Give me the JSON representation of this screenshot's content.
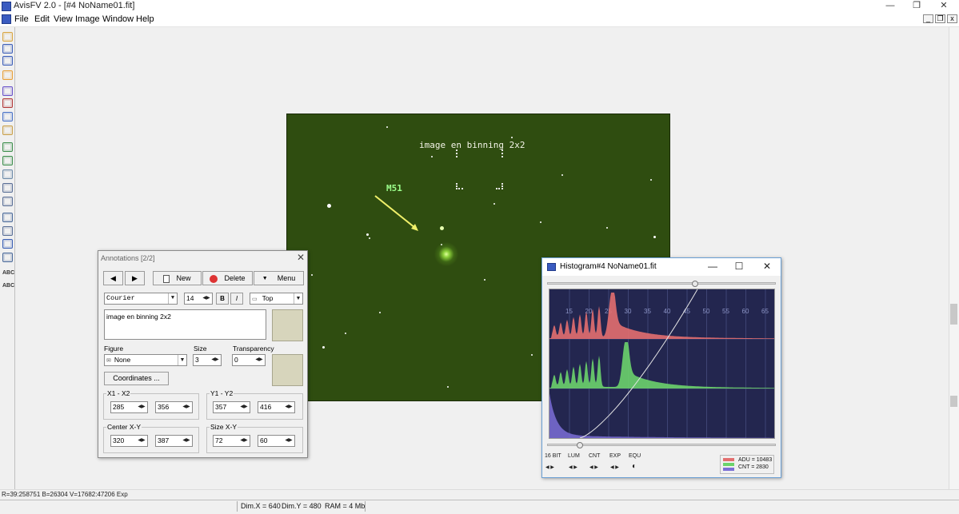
{
  "app": {
    "title": "AvisFV 2.0 - [#4 NoName01.fit]",
    "window_buttons": [
      "—",
      "❐",
      "✕"
    ],
    "mdi_buttons": [
      "_",
      "❐",
      "x"
    ]
  },
  "menu": {
    "items": [
      "File",
      "Edit",
      "View",
      "Image",
      "Window",
      "Help"
    ]
  },
  "toolbar": {
    "icons": [
      "open-icon",
      "save-icon",
      "save-as-icon",
      "folder-icon",
      "refresh-icon",
      "convert-icon",
      "copy-icon",
      "paste-icon",
      "zoom-in-icon",
      "zoom-out-icon",
      "display-icon",
      "crop-icon",
      "target-icon",
      "frame-icon",
      "histogram-icon",
      "levels-icon",
      "sigma-icon",
      "abc-icon",
      "abc-edit-icon"
    ],
    "colors": [
      "#d9a641",
      "#3d5fb8",
      "#3d5fb8",
      "#e8a03a",
      "#6a53c9",
      "#b23a3a",
      "#4a73c7",
      "#c9a04a",
      "#3f8f4e",
      "#3f8f4e",
      "#6c8aa8",
      "#5a6f96",
      "#5a6f96",
      "#4a6a9a",
      "#5a6f96",
      "#3a5fb4",
      "#4a6a9a",
      "#333333",
      "#333333"
    ]
  },
  "image": {
    "caption": "image en binning 2x2",
    "object_label": "M51"
  },
  "annotations": {
    "title": "Annotations  [2/2]",
    "close": "✕",
    "prev": "◀",
    "next": "▶",
    "new_label": "New",
    "delete_label": "Delete",
    "menu_label": "Menu",
    "font": "Courier",
    "font_size": "14",
    "bold": "B",
    "italic": "I",
    "position": "Top",
    "text": "image en binning 2x2",
    "figure_label": "Figure",
    "figure_value": "None",
    "size_label": "Size",
    "size_value": "3",
    "transparency_label": "Transparency",
    "transparency_value": "0",
    "coordinates_label": "Coordinates ...",
    "x_label": "X1 - X2",
    "x1": "285",
    "x2": "356",
    "y_label": "Y1 - Y2",
    "y1": "357",
    "y2": "416",
    "center_label": "Center X-Y",
    "center_x": "320",
    "center_y": "387",
    "sizexy_label": "Size X-Y",
    "size_x": "72",
    "size_y": "60",
    "swatch_color": "#d7d5bc"
  },
  "histogram": {
    "title": "Histogram#4 NoName01.fit",
    "min_btn": "—",
    "max_btn": "☐",
    "close_btn": "✕",
    "scale_labels": [
      "15",
      "20",
      "25",
      "30",
      "35",
      "40",
      "45",
      "50",
      "55",
      "60",
      "65"
    ],
    "controls": [
      "16 BIT",
      "LUM",
      "CNT",
      "EXP",
      "EQU"
    ],
    "adu": "ADU = 10483",
    "cnt": "CNT = 2830",
    "curve_color": "#e6e6e6",
    "legend_colors": [
      "#e36f6f",
      "#6bd36b",
      "#7b6fd6"
    ]
  },
  "status": {
    "readout": "R=39:258751  B=26304  V=17682:47206 Exp",
    "dim_x": "Dim.X = 640",
    "dim_y": "Dim.Y = 480",
    "ram": "RAM = 4 Mb"
  }
}
